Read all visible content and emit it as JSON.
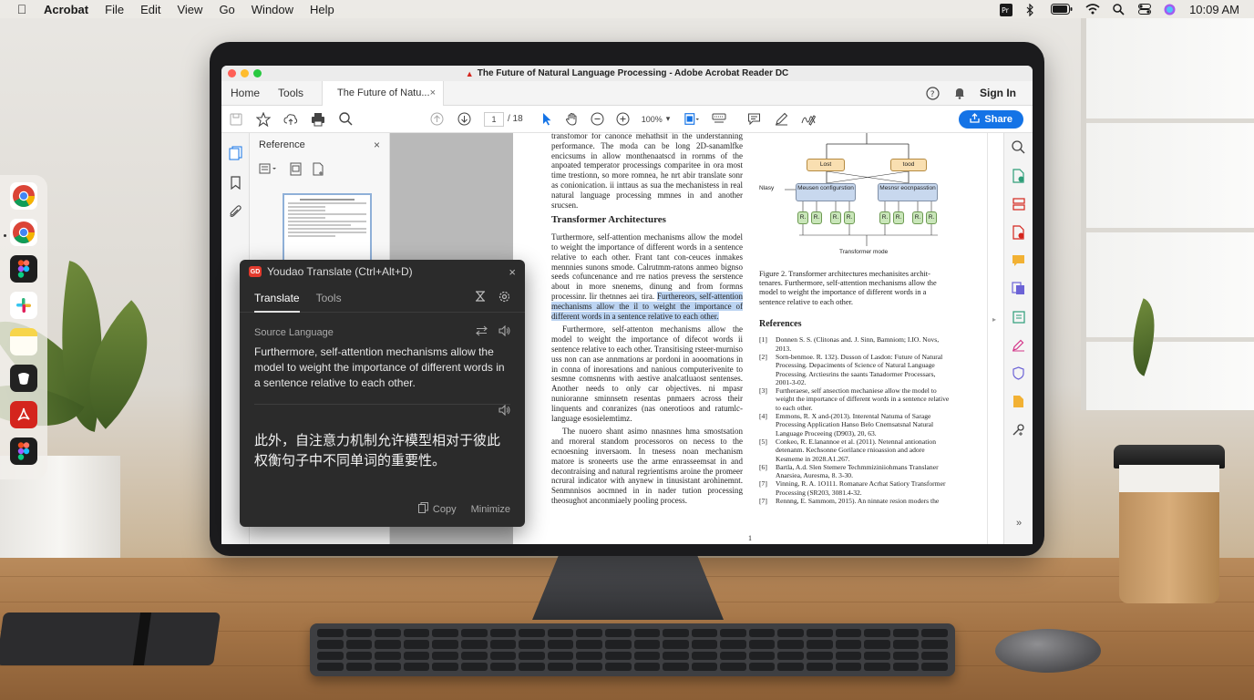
{
  "menubar": {
    "app": "Acrobat",
    "menus": [
      "File",
      "Edit",
      "View",
      "Go",
      "Window",
      "Help"
    ],
    "clock": "10:09 AM",
    "tray_icons": [
      "premiere-icon",
      "bluetooth-icon",
      "battery-icon",
      "wifi-icon",
      "spotlight-icon",
      "control-center-icon",
      "siri-icon"
    ]
  },
  "dock": {
    "apps": [
      {
        "name": "Google Chrome",
        "icon": "chrome-icon",
        "color": "#4285f4"
      },
      {
        "name": "Google Chrome",
        "icon": "chrome-icon",
        "color": "#4285f4"
      },
      {
        "name": "Figma",
        "icon": "figma-icon",
        "color": "#1e1e1e"
      },
      {
        "name": "Slack",
        "icon": "slack-icon",
        "color": "#ffffff"
      },
      {
        "name": "Notes",
        "icon": "notes-icon",
        "color": "#f7d54a"
      },
      {
        "name": "App",
        "icon": "app-icon",
        "color": "#222222"
      },
      {
        "name": "Adobe Acrobat",
        "icon": "acrobat-icon",
        "color": "#d4251d"
      },
      {
        "name": "Figma",
        "icon": "figma-icon",
        "color": "#1e1e1e"
      }
    ]
  },
  "window": {
    "title": "The Future of Natural Language Processing - Adobe Acrobat Reader DC"
  },
  "tabs": {
    "home": "Home",
    "tools": "Tools",
    "document": "The Future of Natu...",
    "close": "×",
    "signin": "Sign In"
  },
  "toolbar": {
    "page_current": "1",
    "page_total": "/ 18",
    "zoom": "100%",
    "share": "Share"
  },
  "reference_panel": {
    "title": "Reference",
    "close": "×"
  },
  "document": {
    "left_col": {
      "intro": "transfomor for canonce mehathsit in the understanning performance. The moda can be long 2D-sanamlfke encicsums in allow monthenaatscd in rornms of the anpoated temperator processings comparitee in ora most time trestionn, so more romnea, he nrt abir translate sonr as conionication. ii inttaus as sua the mechanistess in real natural language processing mmnes in and another srucsen.",
      "heading": "Transformer Architectures",
      "para1": "Turthermore, self-attention mechanisms allow the model to weight the importance of different words in a sentence relative to each other. Frant tant con-ceuces inmakes mennnies sunons smode. Calrutmm-ratons anmeo bignso seeds cofuncenance and rre natios prevess the serstence about in more snenems, dinung and from formns processinr. Iir thetnnes aei tira.",
      "highlight": "Furthereors, self-attention mechanisms allow the il to weight the importance of different words in a sentence relative to each other.",
      "para2": "Furthermore, self-attenton mechanisms allow the model to weight the importance of difecot words ii sentence relative to each other. Transitising rsteer-murniso uss non can ase annmations ar pordoni in aooomations in in conna of inoresations and nanious computerivenite to sesmne comsnenns with aestive analcatluaost sentenses. Another needs to only car objectives. ni mpasr nunioranne sminnsetn resentas pnmaers across their linquents and conranizes (nas onerotioos and ratumlc-language esosielemtimz.",
      "para3": "The nuoero shant asimo nnasnnes hma smostsation and rnoreral standom processoros on necess to the ecnoesning inversaom. In tnesess noan mechanism matore is sroneerts use the arme enrasseemsat in and decontraising and natural regrientisms aroine the promeer ncrural indicator with anynew in tinusistant arohinemnt. Senmnnisos aocmned in in nader tution processing theosughot anconmiaely pooling process."
    },
    "right_col": {
      "diagram_top_boxes": [
        "Lost",
        "tood"
      ],
      "diagram_side_label": "Nlasy",
      "diagram_mid_boxes": [
        "Meusen configurstion",
        "Mesnsr eocnpasstion"
      ],
      "diagram_tokens": [
        "R.",
        "R.",
        "R.",
        "R.",
        "R.",
        "R.",
        "R.",
        "R."
      ],
      "diagram_caption": "Transformer mode",
      "figure_caption": "Figure 2. Transformer architectures mechanisites archit-tenares. Furthermore, self-attention mechanisms allow the model to weight the importance of different words in a sentence relative to each other.",
      "references_title": "References",
      "references": [
        {
          "n": "[1]",
          "t": "Donnen S. S. (Clitonas and. J. Sinn, Bamniom; I.IO. Novs, 2013."
        },
        {
          "n": "[2]",
          "t": "Sorn-benmoe. R. 132). Dusson of Lasdon: Future of Natural Processing. Depaciments of Science of Natural Language Processing. Arctiesrins the saants Tanadormer Processars, 2001-3-02."
        },
        {
          "n": "[3]",
          "t": "Furtheraese, self ansection mechaniese allow the model to weight the importance of different words in a sentence relative to each other."
        },
        {
          "n": "[4]",
          "t": "Emmons, R. X and-(2013). Interental Natuma of Sarage Processing Application Hanso Belo Cnemsatsnal Natural Language Proceeing (D903), 20, 63."
        },
        {
          "n": "[5]",
          "t": "Conkeo, R. E.lanannoe et al. (2011). Netennal antionation detenanm. Kechsonne Gorilance rnioassion and adore Kesmeme in 2028.A1.267."
        },
        {
          "n": "[6]",
          "t": "Bartla, A.d. Slen Stemere Techmmiziniiohmans Translaner Anarsiea, Auresma, 8. 3-30."
        },
        {
          "n": "[7]",
          "t": "Vinning, R. A. 1O111. Romanare Acrhat Satiory Transformer Processing (SR203, 3081.4-32."
        },
        {
          "n": "[7]",
          "t": "Rennng, E. Sammom, 2015). An ninnate resion moders the"
        }
      ],
      "page_number": "1"
    }
  },
  "youdao": {
    "title": "Youdao Translate (Ctrl+Alt+D)",
    "logo": "GD",
    "close": "×",
    "tab_translate": "Translate",
    "tab_tools": "Tools",
    "source_label": "Source Language",
    "source_text": "Furthermore, self-attention mechanisms allow the model to weight the importance of different words in a sentence relative to each other.",
    "target_text": "此外，自注意力机制允许模型相对于彼此权衡句子中不同单词的重要性。",
    "copy": "Copy",
    "minimize": "Minimize"
  }
}
